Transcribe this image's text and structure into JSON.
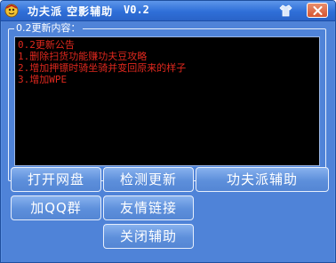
{
  "window": {
    "title": "功夫派  空影辅助",
    "version": "V0.2",
    "icons": {
      "app": "kungfu-app-icon",
      "skin": "skin-shirt-icon",
      "close": "close-icon"
    }
  },
  "notice": {
    "legend": "0.2更新内容：",
    "lines": [
      "0.2更新公告",
      "1.删除扫货功能赚功夫豆攻略",
      "2.增加押镖时骑坐骑并变回原来的样子",
      "3.增加WPE"
    ]
  },
  "buttons": {
    "open_drive": "打开网盘",
    "check_update": "检测更新",
    "kungfu_assist": "功夫派辅助",
    "join_qq": "加QQ群",
    "friend_links": "友情链接",
    "close_assist": "关闭辅助"
  },
  "colors": {
    "titlebar": "#2f6fd8",
    "client_bg": "#4f83d8",
    "console_bg": "#000000",
    "console_text": "#e0281e",
    "button_fill": "#6b9be3"
  }
}
